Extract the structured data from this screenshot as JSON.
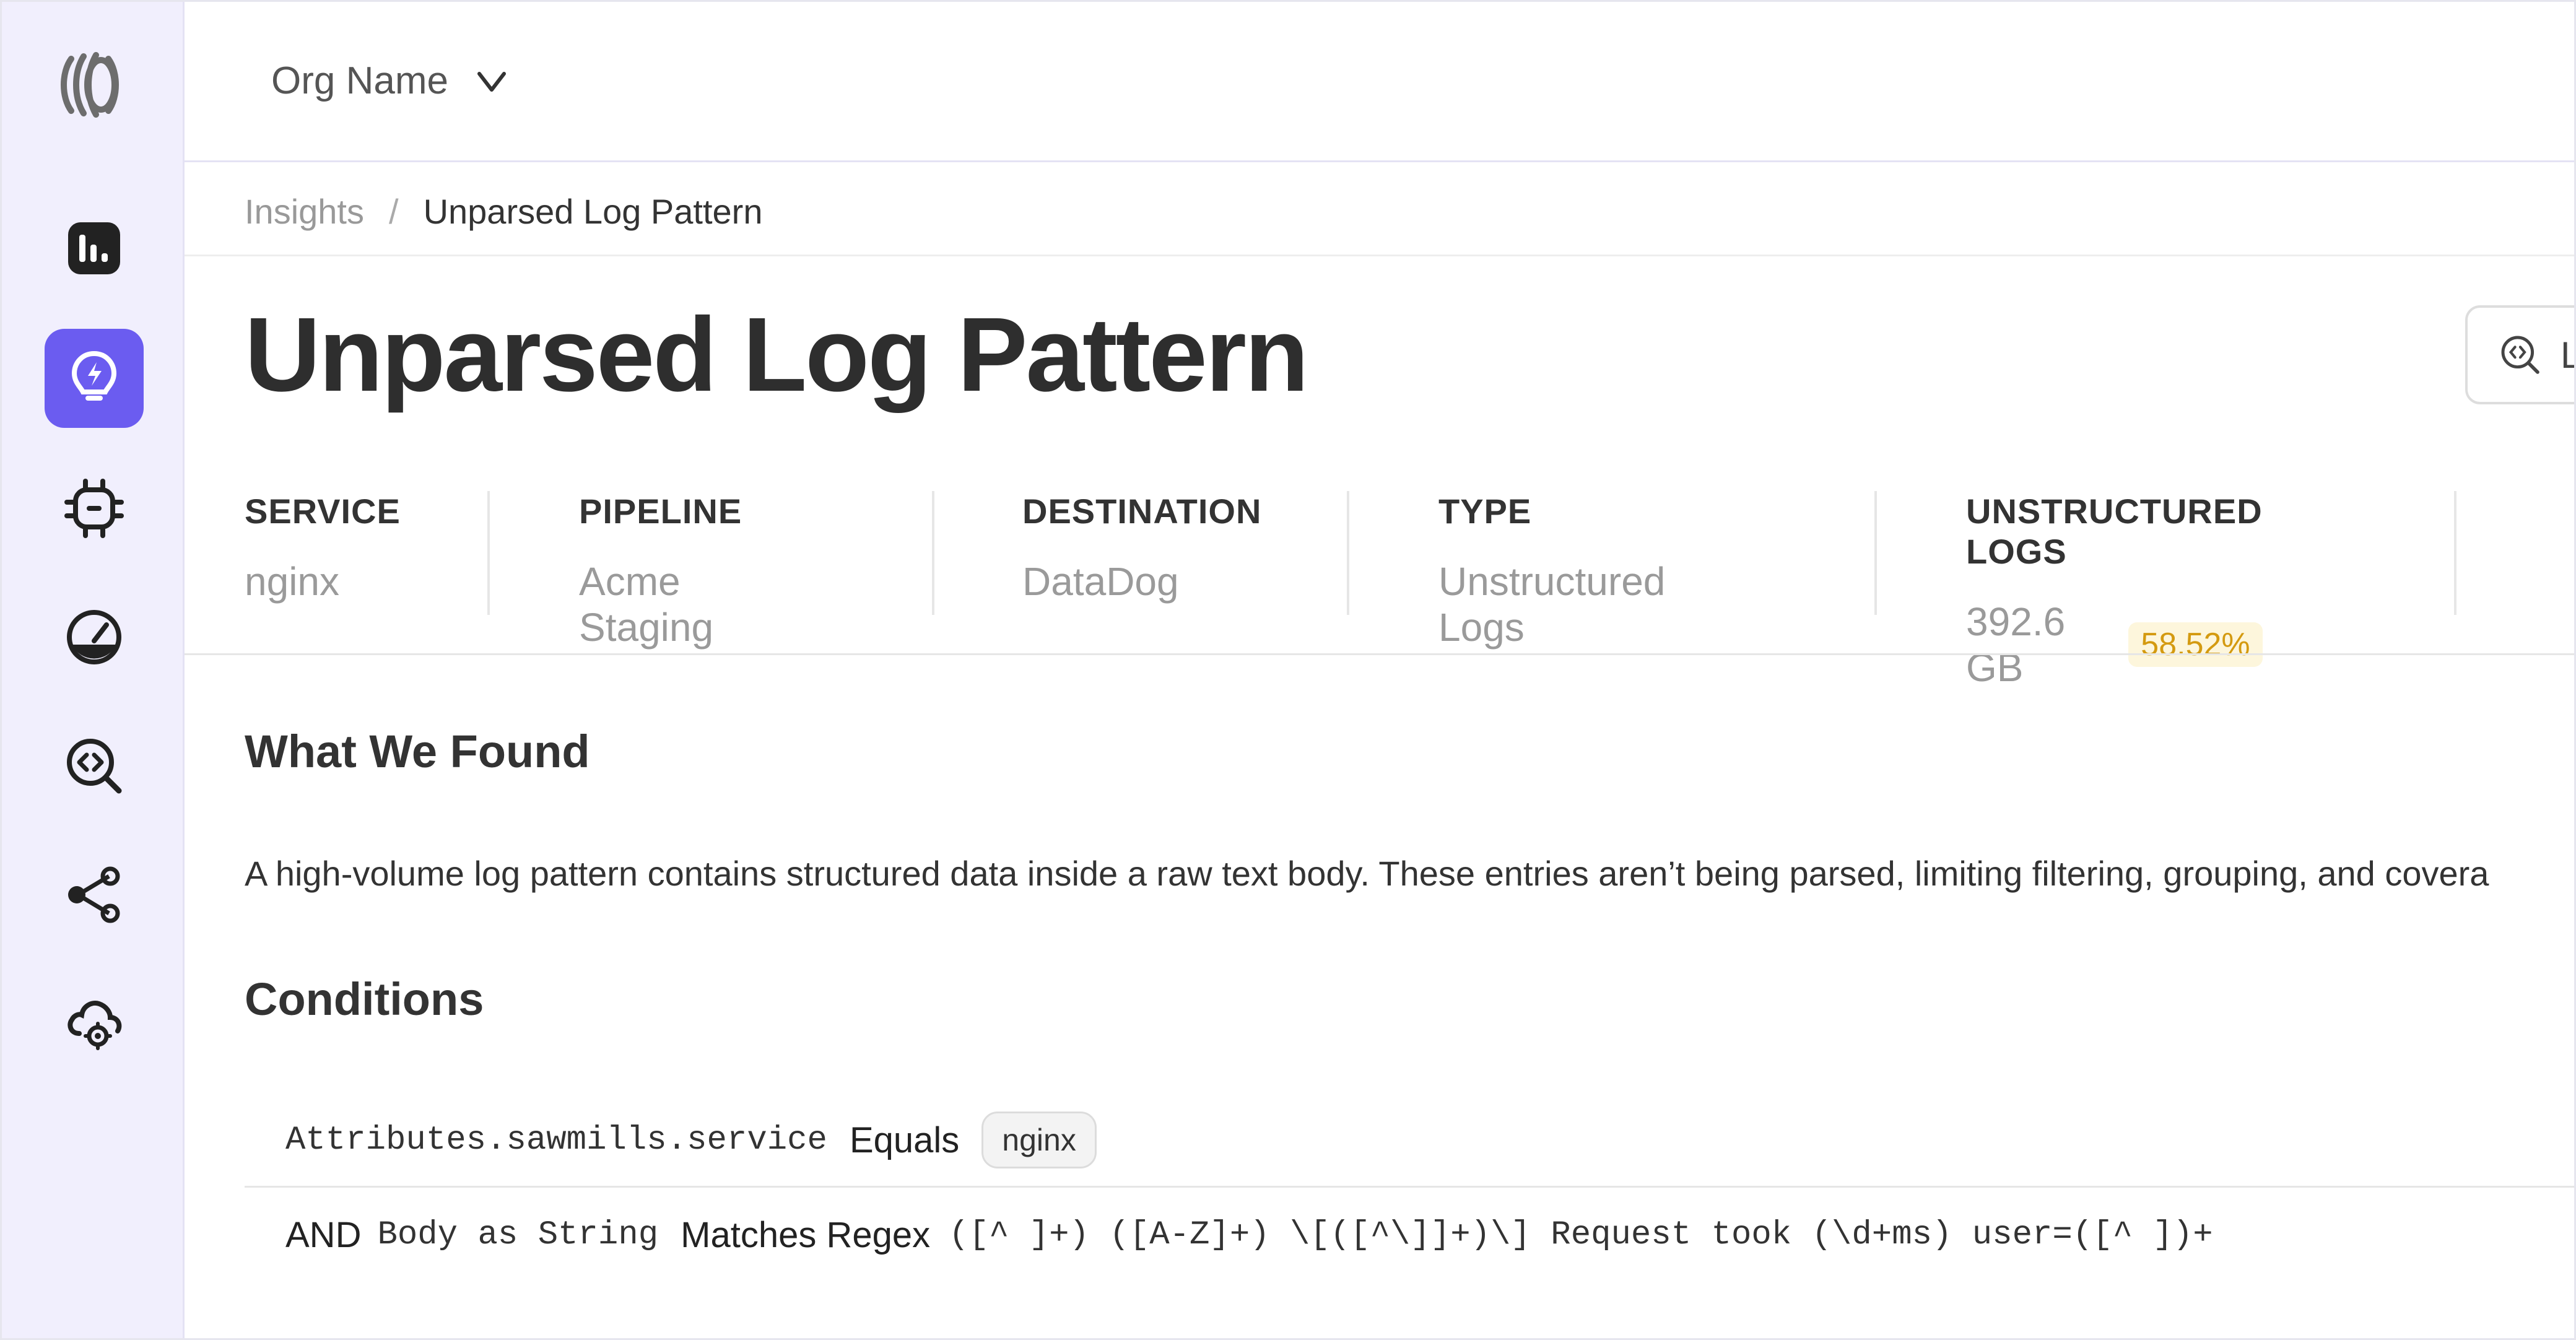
{
  "org": {
    "name": "Org Name"
  },
  "breadcrumb": {
    "parent": "Insights",
    "separator": "/",
    "current": "Unparsed Log Pattern"
  },
  "page": {
    "title": "Unparsed Log Pattern",
    "side_action_label": "L"
  },
  "meta": [
    {
      "label": "SERVICE",
      "value": "nginx"
    },
    {
      "label": "PIPELINE",
      "value": "Acme Staging"
    },
    {
      "label": "DESTINATION",
      "value": "DataDog"
    },
    {
      "label": "TYPE",
      "value": "Unstructured Logs"
    },
    {
      "label": "UNSTRUCTURED LOGS",
      "value": "392.6 GB",
      "badge": "58.52%"
    }
  ],
  "found": {
    "heading": "What We Found",
    "text": "A high-volume log pattern contains structured data inside a raw text body. These entries aren’t being parsed, limiting filtering, grouping, and covera"
  },
  "conditions": {
    "heading": "Conditions",
    "row1": {
      "field": "Attributes.sawmills.service",
      "operator": "Equals",
      "value": "nginx"
    },
    "row2": {
      "joiner": "AND",
      "field": "Body as String",
      "operator": "Matches Regex",
      "value": "([^ ]+) ([A-Z]+) \\[([^\\]]+)\\] Request took (\\d+ms) user=([^ ])+"
    }
  },
  "colors": {
    "accent": "#6b5cf0",
    "sidebar_bg": "#f1effd",
    "badge_text": "#d49a10",
    "badge_bg": "#fdf6dc"
  },
  "icons": [
    "logo-icon",
    "dashboard-icon",
    "insights-bulb-icon",
    "processor-chip-icon",
    "gauge-icon",
    "code-search-icon",
    "share-nodes-icon",
    "cloud-settings-icon",
    "chevron-down-icon"
  ]
}
